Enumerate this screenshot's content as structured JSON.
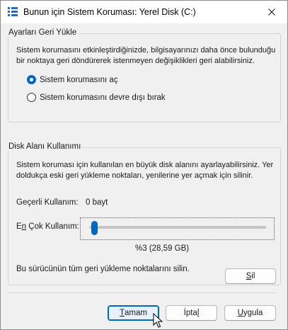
{
  "window": {
    "title": "Bunun için Sistem Koruması: Yerel Disk (C:)",
    "icon": "system-protection-icon",
    "close_icon": "close-icon"
  },
  "restore_settings": {
    "legend": "Ayarları Geri Yükle",
    "description_line1": "Sistem korumasını etkinleştirdiğinizde, bilgisayarınızı daha önce bulunduğu",
    "description_line2": "bir noktaya geri döndürerek istenmeyen değişiklikleri geri alabilirsiniz.",
    "options": [
      {
        "label": "Sistem korumasını aç",
        "checked": true
      },
      {
        "label": "Sistem korumasını devre dışı bırak",
        "checked": false
      }
    ]
  },
  "disk_usage": {
    "legend": "Disk Alanı Kullanımı",
    "description_line1": "Sistem koruması için kullanılan en büyük disk alanını ayarlayabilirsiniz. Yer",
    "description_line2": "doldukça eski geri yükleme noktaları, yenilerine yer açmak için silinir.",
    "current_usage_label": "Geçerli Kullanım:",
    "current_usage_value": "0 bayt",
    "max_usage_label_prefix": "E",
    "max_usage_label_accel": "n",
    "max_usage_label_suffix": " Çok Kullanım:",
    "slider_value": "%3 (28,59 GB)",
    "slider_percent": 3,
    "delete_text": "Bu sürücünün tüm geri yükleme noktalarını silin.",
    "delete_button_accel": "S",
    "delete_button_rest": "il"
  },
  "buttons": {
    "ok_accel": "T",
    "ok_rest": "amam",
    "cancel_prefix": "İpta",
    "cancel_accel": "l",
    "apply_accel": "U",
    "apply_rest": "ygula"
  },
  "colors": {
    "accent": "#0067c0",
    "background": "#f0f0f0"
  }
}
